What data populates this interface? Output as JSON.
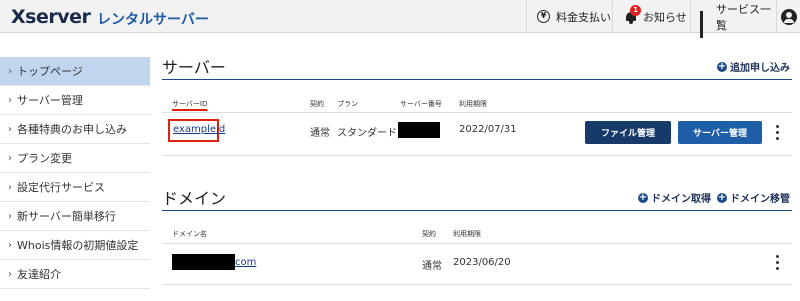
{
  "header": {
    "logo": "Xserver",
    "logo_sub": "レンタルサーバー",
    "nav": {
      "payment": "料金支払い",
      "notices": "お知らせ",
      "notice_badge": "1",
      "services": "サービス一覧"
    }
  },
  "sidebar": {
    "items": [
      {
        "label": "トップページ",
        "active": true
      },
      {
        "label": "サーバー管理"
      },
      {
        "label": "各種特典のお申し込み"
      },
      {
        "label": "プラン変更"
      },
      {
        "label": "設定代行サービス"
      },
      {
        "label": "新サーバー簡単移行"
      },
      {
        "label": "Whois情報の初期値設定"
      },
      {
        "label": "友達紹介"
      }
    ],
    "chevron": "›"
  },
  "server": {
    "title": "サーバー",
    "add_label": "追加申し込み",
    "columns": {
      "id": "サーバーID",
      "contract": "契約",
      "plan": "プラン",
      "number": "サーバー番号",
      "expiry": "利用期限"
    },
    "row": {
      "id": "exampleid",
      "contract": "通常",
      "plan": "スタンダード",
      "expiry": "2022/07/31",
      "file_button": "ファイル管理",
      "server_button": "サーバー管理"
    }
  },
  "domain": {
    "title": "ドメイン",
    "acquire_label": "ドメイン取得",
    "transfer_label": "ドメイン移管",
    "columns": {
      "name": "ドメイン名",
      "contract": "契約",
      "expiry": "利用期限"
    },
    "row": {
      "suffix": "com",
      "contract": "通常",
      "expiry": "2023/06/20"
    }
  },
  "colors": {
    "accent": "#163a6a",
    "active_sidebar": "#bfd6ee",
    "highlight": "#dd2211"
  }
}
